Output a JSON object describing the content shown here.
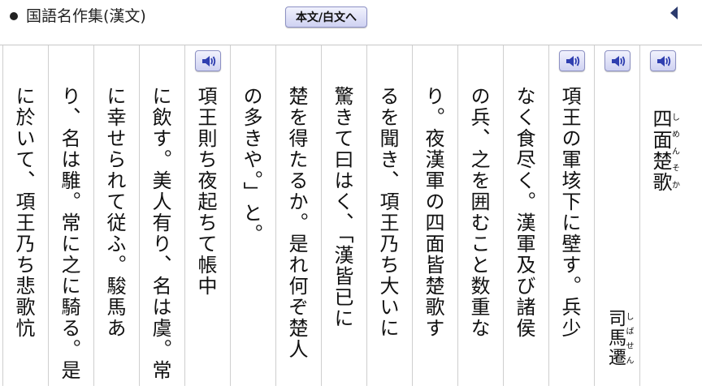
{
  "header": {
    "title": "国語名作集(漢文)",
    "mode_button_label": "本文/白文へ"
  },
  "icons": {
    "bullet": "filled-circle",
    "back": "triangle-left",
    "audio": "speaker-icon"
  },
  "colors": {
    "button_border": "#8d91c4",
    "button_top": "#f1f2fd",
    "button_bottom": "#cfd2f2",
    "speaker_blue": "#2f3fb0",
    "back_arrow": "#2b3a6d",
    "divider": "#cfcfcf"
  },
  "poem": {
    "title": "四面楚歌",
    "title_reading": "しめんそか",
    "author": "司馬遷",
    "author_reading": "しばせん"
  },
  "columns": [
    {
      "text": "項王の軍垓下に壁す。兵少"
    },
    {
      "text": "なく食尽く。漢軍及び諸侯"
    },
    {
      "text": "の兵、之を囲むこと数重な"
    },
    {
      "text": "り。夜漢軍の四面皆楚歌す"
    },
    {
      "text": "るを聞き、項王乃ち大いに"
    },
    {
      "text": "驚きて曰はく、「漢皆已に"
    },
    {
      "text": "楚を得たるか。是れ何ぞ楚人"
    },
    {
      "text": "の多きや。」と。"
    },
    {
      "text": "項王則ち夜起ちて帳中"
    },
    {
      "text": "に飲す。美人有り、名は虞。常"
    },
    {
      "text": "に幸せられて従ふ。駿馬あ"
    },
    {
      "text": "り、名は騅。常に之に騎る。是"
    },
    {
      "text": "に於いて、項王乃ち悲歌忼"
    }
  ]
}
